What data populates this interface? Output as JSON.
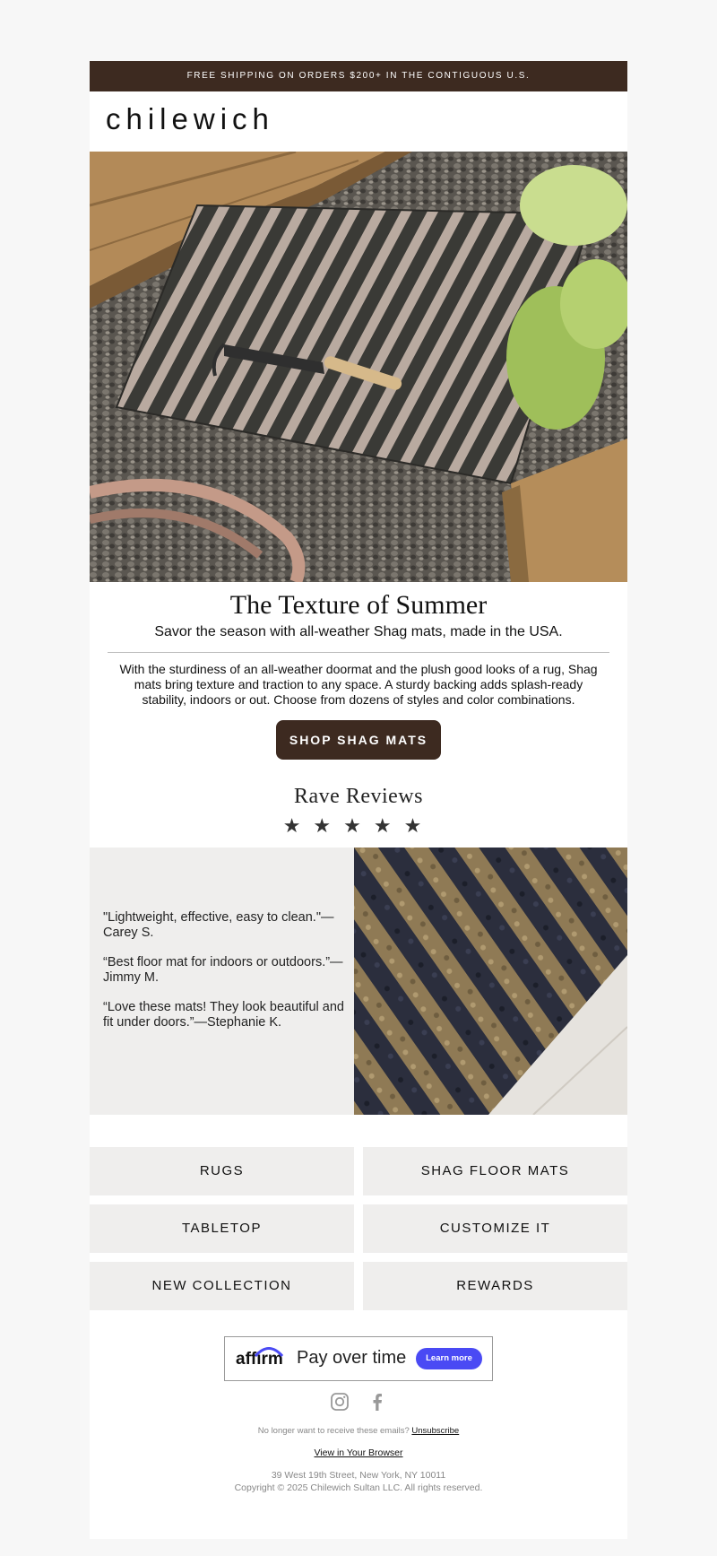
{
  "topbar": {
    "text": "FREE SHIPPING ON ORDERS $200+ IN THE CONTIGUOUS U.S."
  },
  "brand": {
    "logo": "chilewich"
  },
  "hero": {
    "title": "The Texture of Summer",
    "subtitle": "Savor the season with all-weather Shag mats, made in the USA.",
    "body": "With the sturdiness of an all-weather doormat and the plush good looks of a rug, Shag mats bring texture and traction to any space. A sturdy backing adds splash-ready stability, indoors or out. Choose from dozens of styles and color combinations.",
    "cta": "SHOP SHAG MATS"
  },
  "reviews": {
    "title": "Rave Reviews",
    "stars": "★★★★★",
    "rating": 5,
    "items": [
      "\"Lightweight, effective, easy to clean.\"—Carey S.",
      "“Best floor mat for indoors or outdoors.”—Jimmy M.",
      "“Love these mats! They look beautiful and fit under doors.”—Stephanie K."
    ]
  },
  "nav": {
    "rugs": "RUGS",
    "shag": "SHAG FLOOR MATS",
    "tabletop": "TABLETOP",
    "customize": "CUSTOMIZE IT",
    "new_collection": "NEW COLLECTION",
    "rewards": "REWARDS"
  },
  "affirm": {
    "logo": "affirm",
    "text": "Pay over time",
    "button": "Learn more"
  },
  "footer": {
    "social_icons": [
      "instagram-icon",
      "facebook-icon"
    ],
    "unsub_text": "No longer want to receive these emails?",
    "unsub_link": "Unsubscribe",
    "browser_link": "View in Your Browser",
    "address": "39 West 19th Street, New York, NY 10011",
    "copyright": "Copyright © 2025 Chilewich Sultan LLC. All rights reserved."
  },
  "colors": {
    "brand_brown": "#3d2a20",
    "panel_gray": "#efeeed",
    "affirm_blue": "#4a4af4"
  }
}
